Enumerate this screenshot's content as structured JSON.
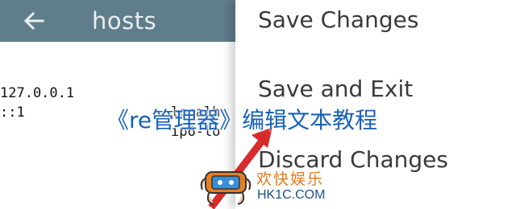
{
  "appbar": {
    "back_icon": "arrow-left-icon",
    "title": "hosts",
    "color": "#607d8b"
  },
  "editor": {
    "lines": [
      {
        "ip": "127.0.0.1",
        "host": "localh"
      },
      {
        "ip": "::1",
        "host": "ip6-lo"
      }
    ]
  },
  "menu": {
    "items": [
      "Save Changes",
      "Save and Exit",
      "Discard Changes"
    ]
  },
  "overlay": {
    "caption": "《re管理器》编辑文本教程",
    "caption_color": "#1762b8",
    "arrow_color": "#d92b2b",
    "watermark_name": "欢快娱乐",
    "watermark_url": "HK1C.COM"
  }
}
